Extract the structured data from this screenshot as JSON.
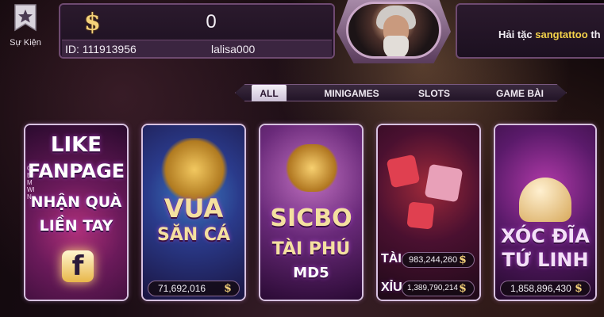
{
  "event": {
    "label": "Sự Kiện",
    "icon": "event-star-icon"
  },
  "profile": {
    "balance": "0",
    "id_text": "ID: 111913956",
    "username": "lalisa000",
    "coin_icon": "dollar-coin-icon"
  },
  "notification": {
    "prefix": "Hải tặc ",
    "highlight": "sangtattoo",
    "suffix": " th"
  },
  "tabs": [
    {
      "label": "ALL",
      "active": true
    },
    {
      "label": "MINIGAMES",
      "active": false
    },
    {
      "label": "SLOTS",
      "active": false
    },
    {
      "label": "GAME BÀI",
      "active": false
    }
  ],
  "cards": {
    "fanpage": {
      "line1": "LIKE",
      "line2": "FANPAGE",
      "line3": "NHẬN QUÀ",
      "line4": "LIỀN TAY",
      "side": "GEMWIN",
      "icon": "facebook-icon"
    },
    "vua_san_ca": {
      "line1": "VUA",
      "line2": "SĂN CÁ",
      "jackpot": "71,692,016"
    },
    "sicbo": {
      "line1": "SICBO",
      "line2": "TÀI PHÚ",
      "line3": "MD5"
    },
    "tai_xiu": {
      "tai_label": "TÀI",
      "tai_value": "983,244,260",
      "xiu_label": "XỈU",
      "xiu_value": "1,389,790,214"
    },
    "xoc_dia": {
      "line1": "XÓC ĐĨA",
      "line2": "TỨ LINH",
      "jackpot": "1,858,896,430"
    }
  },
  "colors": {
    "accent_gold": "#f4d24a",
    "panel_border": "#6e4a70",
    "card_border": "#d7c1e0"
  }
}
